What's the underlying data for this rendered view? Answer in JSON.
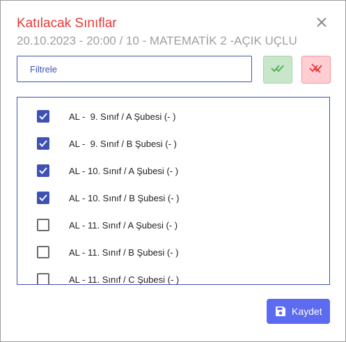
{
  "dialog": {
    "title": "Katılacak Sınıflar",
    "subtitle": "20.10.2023 - 20:00 / 10 - MATEMATİK 2 -AÇIK UÇLU"
  },
  "filter": {
    "placeholder": "Filtrele"
  },
  "icons": {
    "close": "close-icon",
    "select_all": "double-check-icon",
    "deselect_all": "double-check-off-icon",
    "save": "save-icon"
  },
  "colors": {
    "title": "#e53935",
    "accent": "#3f51b5",
    "select_all_bg": "#c8e6c9",
    "deselect_all_bg": "#ffcdd2",
    "save_bg": "#5c6bf0"
  },
  "classes": [
    {
      "label": "AL -  9. Sınıf / A Şubesi (- )",
      "checked": true
    },
    {
      "label": "AL -  9. Sınıf / B Şubesi (- )",
      "checked": true
    },
    {
      "label": "AL - 10. Sınıf / A Şubesi (- )",
      "checked": true
    },
    {
      "label": "AL - 10. Sınıf / B Şubesi (- )",
      "checked": true
    },
    {
      "label": "AL - 11. Sınıf / A Şubesi (- )",
      "checked": false
    },
    {
      "label": "AL - 11. Sınıf / B Şubesi (- )",
      "checked": false
    },
    {
      "label": "AL - 11. Sınıf / C Şubesi (- )",
      "checked": false
    }
  ],
  "footer": {
    "save_label": "Kaydet"
  }
}
